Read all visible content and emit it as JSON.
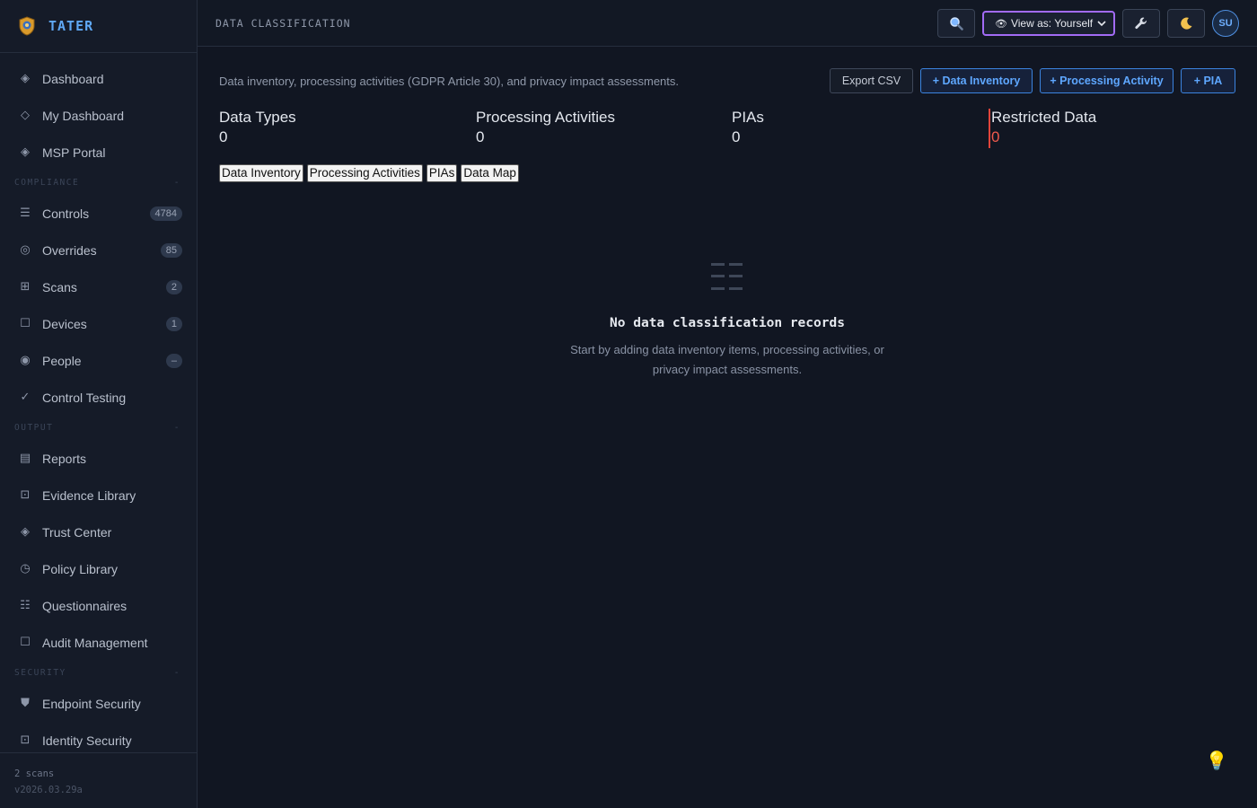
{
  "brand": {
    "name": "TATER"
  },
  "sidebar": {
    "items_top": [
      {
        "label": "Dashboard",
        "icon": "◈"
      },
      {
        "label": "My Dashboard",
        "icon": "◇"
      },
      {
        "label": "MSP Portal",
        "icon": "◈"
      }
    ],
    "sections": [
      {
        "title": "COMPLIANCE",
        "items": [
          {
            "label": "Controls",
            "icon": "☰",
            "badge": "4784"
          },
          {
            "label": "Overrides",
            "icon": "◎",
            "badge": "85"
          },
          {
            "label": "Scans",
            "icon": "⊞",
            "badge": "2"
          },
          {
            "label": "Devices",
            "icon": "☐",
            "badge": "1"
          },
          {
            "label": "People",
            "icon": "◉",
            "badge": "–"
          },
          {
            "label": "Control Testing",
            "icon": "✓"
          }
        ]
      },
      {
        "title": "OUTPUT",
        "items": [
          {
            "label": "Reports",
            "icon": "▤"
          },
          {
            "label": "Evidence Library",
            "icon": "⊡"
          },
          {
            "label": "Trust Center",
            "icon": "◈"
          },
          {
            "label": "Policy Library",
            "icon": "◷"
          },
          {
            "label": "Questionnaires",
            "icon": "☷"
          },
          {
            "label": "Audit Management",
            "icon": "☐"
          }
        ]
      },
      {
        "title": "SECURITY",
        "items": [
          {
            "label": "Endpoint Security",
            "icon": "⛊"
          },
          {
            "label": "Identity Security",
            "icon": "⊡"
          }
        ]
      }
    ],
    "section_toggle": "-",
    "footer": {
      "scans": "2 scans",
      "version": "v2026.03.29a"
    }
  },
  "topbar": {
    "title": "DATA CLASSIFICATION",
    "view_as": "View as: Yourself",
    "avatar": "SU"
  },
  "main": {
    "intro": "Data inventory, processing activities (GDPR Article 30), and privacy impact assessments.",
    "actions": {
      "export": "Export CSV",
      "add_inventory": "+ Data Inventory",
      "add_activity": "+ Processing Activity",
      "add_pia": "+ PIA"
    },
    "stats": [
      {
        "label": "Data Types",
        "value": "0"
      },
      {
        "label": "Processing Activities",
        "value": "0"
      },
      {
        "label": "PIAs",
        "value": "0"
      },
      {
        "label": "Restricted Data",
        "value": "0"
      }
    ],
    "tabs": [
      "Data Inventory",
      "Processing Activities",
      "PIAs",
      "Data Map"
    ],
    "empty": {
      "title": "No data classification records",
      "desc_line1": "Start by adding data inventory items, processing activities, or",
      "desc_line2": "privacy impact assessments."
    }
  },
  "colors": {
    "accent": "#5ea7ff",
    "view_as_border": "#a26bf5",
    "restricted": "#ef5a4d"
  }
}
